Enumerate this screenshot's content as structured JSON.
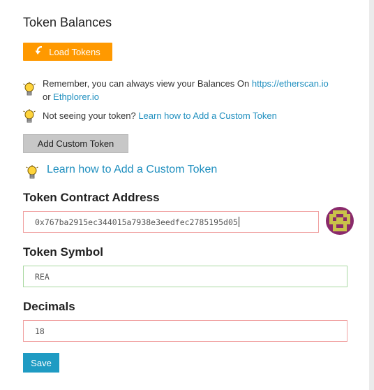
{
  "section": {
    "title": "Token Balances"
  },
  "load_button": {
    "label": "Load Tokens",
    "color": "#ff9900"
  },
  "tips": {
    "balances_text_1": "Remember, you can always view your Balances On ",
    "etherscan_link": "https://etherscan.io",
    "or_text": "or ",
    "ethplorer_link": "Ethplorer.io",
    "not_seeing_text": "Not seeing your token? ",
    "custom_token_link": "Learn how to Add a Custom Token"
  },
  "add_custom_button": {
    "label": "Add Custom Token"
  },
  "big_tip": {
    "link": "Learn how to Add a Custom Token"
  },
  "contract_field": {
    "label": "Token Contract Address",
    "value": "0x767ba2915ec344015a7938e3eedfec2785195d05",
    "state": "error"
  },
  "symbol_field": {
    "label": "Token Symbol",
    "value": "REA",
    "state": "valid"
  },
  "decimals_field": {
    "label": "Decimals",
    "value": "18",
    "state": "error"
  },
  "save_button": {
    "label": "Save",
    "color": "#1f9bc3"
  },
  "colors": {
    "link": "#1f8fbf",
    "error_border": "#f0a0a0",
    "valid_border": "#a8d8a0"
  }
}
